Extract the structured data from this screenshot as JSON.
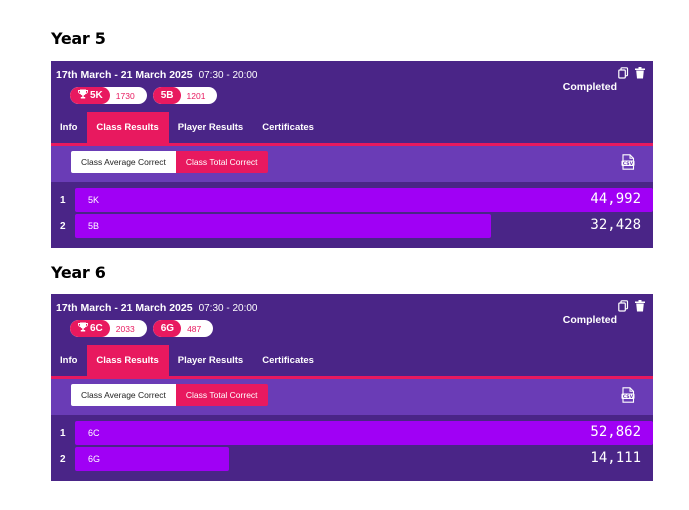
{
  "sections": [
    {
      "heading": "Year 5",
      "date": "17th March - 21 March 2025",
      "time": "07:30 - 20:00",
      "status": "Completed",
      "badges": [
        {
          "class": "5K",
          "score": "1730",
          "trophy": true
        },
        {
          "class": "5B",
          "score": "1201",
          "trophy": false
        }
      ],
      "tabs": [
        "Info",
        "Class Results",
        "Player Results",
        "Certificates"
      ],
      "active_tab": "Class Results",
      "segments": [
        "Class Average Correct",
        "Class Total Correct"
      ],
      "rows": [
        {
          "rank": "1",
          "label": "5K",
          "value": "44,992",
          "fraction": 1.0
        },
        {
          "rank": "2",
          "label": "5B",
          "value": "32,428",
          "fraction": 0.72
        }
      ]
    },
    {
      "heading": "Year 6",
      "date": "17th March - 21 March 2025",
      "time": "07:30 - 20:00",
      "status": "Completed",
      "badges": [
        {
          "class": "6C",
          "score": "2033",
          "trophy": true
        },
        {
          "class": "6G",
          "score": "487",
          "trophy": false
        }
      ],
      "tabs": [
        "Info",
        "Class Results",
        "Player Results",
        "Certificates"
      ],
      "active_tab": "Class Results",
      "segments": [
        "Class Average Correct",
        "Class Total Correct"
      ],
      "rows": [
        {
          "rank": "1",
          "label": "6C",
          "value": "52,862",
          "fraction": 1.0
        },
        {
          "rank": "2",
          "label": "6G",
          "value": "14,111",
          "fraction": 0.267
        }
      ]
    }
  ],
  "colors": {
    "panel": "#4a2587",
    "subbar": "#6a3cb6",
    "accent": "#e8195f",
    "bar": "#a000f5"
  },
  "icons": [
    "copy-icon",
    "trash-icon",
    "trophy-icon",
    "csv-file-icon"
  ]
}
